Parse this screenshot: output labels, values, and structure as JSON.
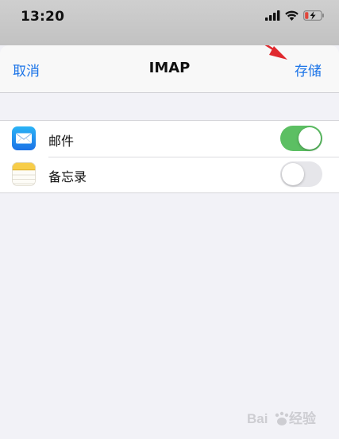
{
  "status_bar": {
    "time": "13:20",
    "icons": [
      "cellular-signal-icon",
      "wifi-icon",
      "battery-charging-icon"
    ],
    "battery_color": "#e0463b"
  },
  "nav": {
    "cancel_label": "取消",
    "title": "IMAP",
    "save_label": "存储"
  },
  "list": {
    "items": [
      {
        "label": "邮件",
        "icon": "mail-app-icon",
        "toggle_on": true
      },
      {
        "label": "备忘录",
        "icon": "notes-app-icon",
        "toggle_on": false
      }
    ]
  },
  "colors": {
    "accent": "#1a73e8",
    "toggle_on": "#5cbf63",
    "annotation_arrow": "#e0292e"
  },
  "watermark": {
    "logo": "baidu-jingyan-logo"
  }
}
